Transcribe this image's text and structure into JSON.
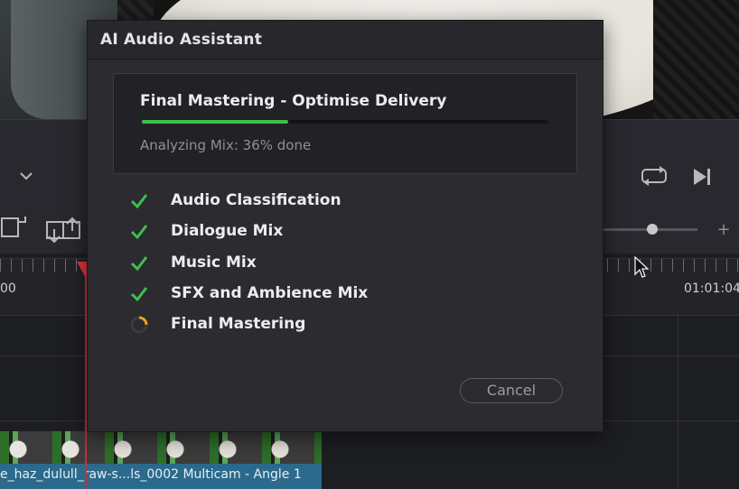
{
  "dialog": {
    "title": "AI Audio Assistant",
    "progress": {
      "title": "Final Mastering - Optimise Delivery",
      "status": "Analyzing Mix: 36% done",
      "percent": 36,
      "bar_color": "#3fbf4d"
    },
    "steps": [
      {
        "label": "Audio Classification",
        "state": "done"
      },
      {
        "label": "Dialogue Mix",
        "state": "done"
      },
      {
        "label": "Music Mix",
        "state": "done"
      },
      {
        "label": "SFX and Ambience Mix",
        "state": "done"
      },
      {
        "label": "Final Mastering",
        "state": "in-progress"
      }
    ],
    "cancel_label": "Cancel",
    "colors": {
      "check": "#3fbf4d",
      "spinner": "#f0a020"
    }
  },
  "timeline": {
    "timecode_left": "00",
    "timecode_right": "01:01:04",
    "clip_label": "e_haz_dulull_raw-s...ls_0002 Multicam - Angle 1",
    "clip_color": "#2b6a8c",
    "playhead_color": "#e2353f"
  },
  "icons": {
    "toolbar": [
      "chevron-down-icon",
      "insert-clip-icon",
      "replace-clip-icon",
      "loop-icon",
      "next-frame-icon",
      "zoom-in-icon"
    ],
    "cursor": "mouse-pointer-icon"
  }
}
